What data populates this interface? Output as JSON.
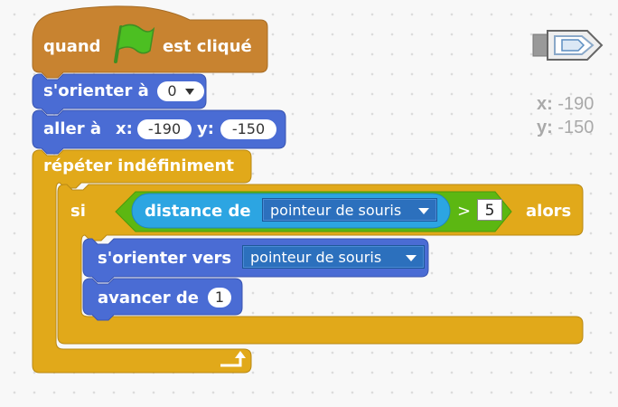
{
  "colors": {
    "events": "#c88330",
    "motion": "#4a6cd4",
    "control": "#e1a91a",
    "operators": "#5cb712",
    "sensing": "#2ca5e2"
  },
  "script": {
    "hat_when": "quand",
    "hat_flag_icon": "green-flag-icon",
    "hat_clicked": "est cliqué",
    "point_in_direction": {
      "label": "s'orienter à",
      "value": "0"
    },
    "go_to": {
      "label": "aller à",
      "x_label": "x:",
      "x_value": "-190",
      "y_label": "y:",
      "y_value": "-150"
    },
    "forever": "répéter indéfiniment",
    "if_label": "si",
    "distance": {
      "label": "distance de",
      "target": "pointeur de souris"
    },
    "greater_than": ">",
    "threshold": "5",
    "then_label": "alors",
    "point_towards": {
      "label": "s'orienter vers",
      "target": "pointeur de souris"
    },
    "move": {
      "label": "avancer de",
      "value": "1"
    },
    "loop_arrow_icon": "loop-arrow-icon"
  },
  "sprite": {
    "icon": "boat-sprite-icon",
    "x_label": "x:",
    "x_value": "-190",
    "y_label": "y:",
    "y_value": "-150"
  }
}
